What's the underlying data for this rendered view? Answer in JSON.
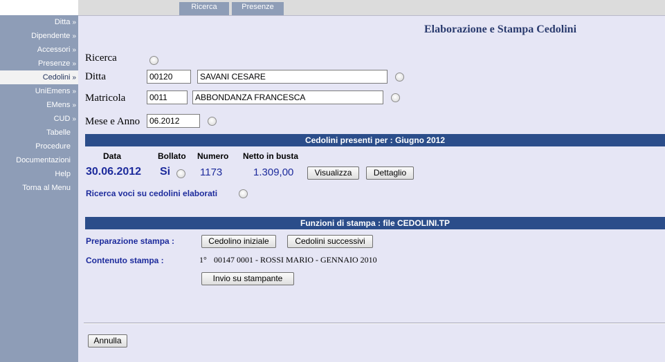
{
  "sidebar": {
    "items": [
      {
        "label": "Ditta",
        "arrow": "»"
      },
      {
        "label": "Dipendente",
        "arrow": "»"
      },
      {
        "label": "Accessori",
        "arrow": "»"
      },
      {
        "label": "Presenze",
        "arrow": "»"
      },
      {
        "label": "Cedolini",
        "arrow": "»",
        "active": true
      },
      {
        "label": "UniEmens",
        "arrow": "»"
      },
      {
        "label": "EMens",
        "arrow": "»"
      },
      {
        "label": "CUD",
        "arrow": "»"
      },
      {
        "label": "Tabelle"
      },
      {
        "label": "Procedure"
      },
      {
        "label": "Documentazioni"
      },
      {
        "label": "Help"
      },
      {
        "label": "Torna al Menu"
      }
    ]
  },
  "tabs": [
    "Ricerca",
    "Presenze"
  ],
  "page_title": "Elaborazione e Stampa Cedolini",
  "form": {
    "ricerca_label": "Ricerca",
    "ditta_label": "Ditta",
    "ditta_code": "00120",
    "ditta_name": "SAVANI CESARE",
    "matricola_label": "Matricola",
    "matricola_code": "0011",
    "matricola_name": "ABBONDANZA FRANCESCA",
    "mese_anno_label": "Mese e Anno",
    "mese_anno_value": "06.2012"
  },
  "cedolini": {
    "header": "Cedolini presenti per : Giugno 2012",
    "columns": [
      "Data",
      "Bollato",
      "Numero",
      "Netto in busta"
    ],
    "row": {
      "data": "30.06.2012",
      "bollato": "Si",
      "numero": "1173",
      "netto": "1.309,00"
    },
    "visualizza_label": "Visualizza",
    "dettaglio_label": "Dettaglio",
    "ricerca_voci_label": "Ricerca voci su cedolini elaborati"
  },
  "stampa": {
    "header": "Funzioni di stampa : file CEDOLINI.TP",
    "preparazione_label": "Preparazione stampa :",
    "cedolino_iniziale_label": "Cedolino iniziale",
    "cedolini_successivi_label": "Cedolini successivi",
    "contenuto_label": "Contenuto stampa :",
    "contenuto_index": "1°",
    "contenuto_value": "00147 0001 - ROSSI MARIO - GENNAIO 2010",
    "invio_label": "Invio su stampante"
  },
  "annulla_label": "Annulla",
  "colors": {
    "sidebar_bg": "#8e9db7",
    "page_bg": "#e6e6f5",
    "bar_bg": "#2b4d8a",
    "link_blue": "#1d2b9c",
    "title_color": "#2a3b6e"
  }
}
